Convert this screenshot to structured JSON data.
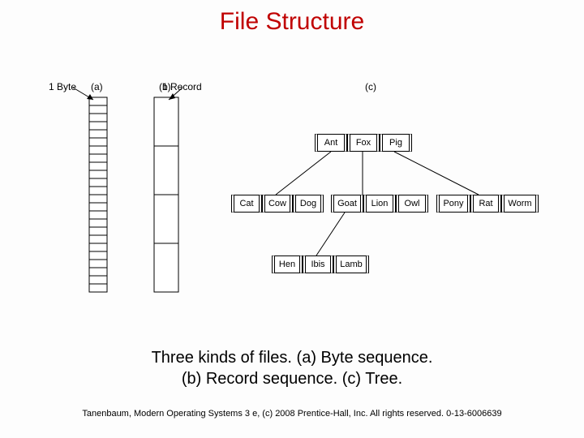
{
  "title": "File Structure",
  "labels": {
    "byte": "1 Byte",
    "record": "1 Record",
    "a": "(a)",
    "b": "(b)",
    "c": "(c)"
  },
  "tree": {
    "row1": [
      "Ant",
      "Fox",
      "Pig"
    ],
    "row2a": [
      "Cat",
      "Cow",
      "Dog"
    ],
    "row2b": [
      "Goat",
      "Lion",
      "Owl"
    ],
    "row2c": [
      "Pony",
      "Rat",
      "Worm"
    ],
    "row3": [
      "Hen",
      "Ibis",
      "Lamb"
    ]
  },
  "caption_line1": "Three kinds of files. (a) Byte sequence.",
  "caption_line2": "(b) Record sequence. (c) Tree.",
  "footer": "Tanenbaum, Modern Operating Systems 3 e, (c) 2008 Prentice-Hall, Inc. All rights reserved. 0-13-6006639"
}
